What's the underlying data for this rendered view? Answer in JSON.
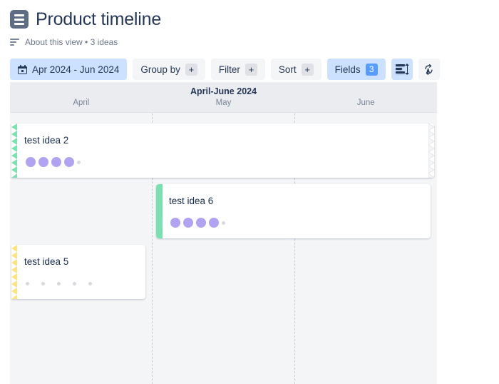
{
  "header": {
    "view_icon": "list-view-icon",
    "title": "Product timeline",
    "about_icon": "about-lines-icon",
    "subtitle": "About this view • 3 ideas"
  },
  "toolbar": {
    "date_range": {
      "icon": "calendar-icon",
      "label": "Apr 2024 - Jun 2024",
      "active": true
    },
    "group_by": {
      "label": "Group by",
      "chip": "+"
    },
    "filter": {
      "label": "Filter",
      "chip": "+"
    },
    "sort": {
      "label": "Sort",
      "chip": "+"
    },
    "fields": {
      "label": "Fields",
      "count": "3",
      "active": true
    },
    "row_height": {
      "icon": "row-height-icon",
      "active": true
    },
    "auto_text": {
      "icon": "auto-text-icon",
      "active": false
    }
  },
  "timeline": {
    "range_label": "April-June 2024",
    "months": [
      "April",
      "May",
      "June"
    ],
    "colors": {
      "accent_green": "#79e2b0",
      "accent_yellow": "#ffe380",
      "dot_filled": "#b2a3f2",
      "dot_empty": "#d7d9de",
      "panel_bg": "#f4f5f7",
      "header_bg": "#ebecf0",
      "badge_blue": "#579dff",
      "active_btn": "#cce0ff"
    },
    "bars": [
      {
        "title": "test idea 2",
        "accent_color": "#79e2b0",
        "continues_left": true,
        "continues_right": true,
        "filled_dots": 4,
        "empty_dots": 1
      },
      {
        "title": "test idea 6",
        "accent_color": "#79e2b0",
        "continues_left": false,
        "continues_right": false,
        "filled_dots": 4,
        "empty_dots": 1
      },
      {
        "title": "test idea 5",
        "accent_color": "#ffe380",
        "continues_left": true,
        "continues_right": false,
        "filled_dots": 0,
        "empty_dots": 5
      }
    ]
  }
}
